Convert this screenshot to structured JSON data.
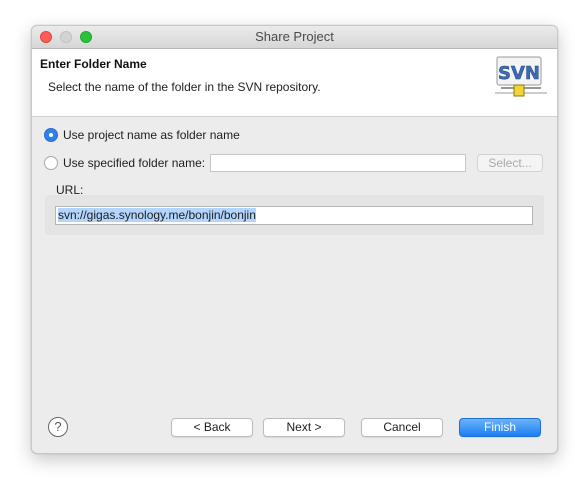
{
  "window": {
    "title": "Share Project"
  },
  "header": {
    "title": "Enter Folder Name",
    "description": "Select the name of the folder in the SVN repository.",
    "logo_text": "SVN"
  },
  "options": {
    "use_project_name": {
      "label": "Use project name as folder name",
      "selected": true
    },
    "use_specified_name": {
      "label": "Use specified folder name:",
      "selected": false
    },
    "folder_name_value": "",
    "select_button_label": "Select..."
  },
  "url": {
    "label": "URL:",
    "value": "svn://gigas.synology.me/bonjin/bonjin"
  },
  "buttons": {
    "help": "?",
    "back": "< Back",
    "next": "Next >",
    "cancel": "Cancel",
    "finish": "Finish"
  },
  "colors": {
    "accent": "#2f80ed",
    "finish_button": "#1c7ef3",
    "selection_highlight": "#b3d4fc"
  }
}
